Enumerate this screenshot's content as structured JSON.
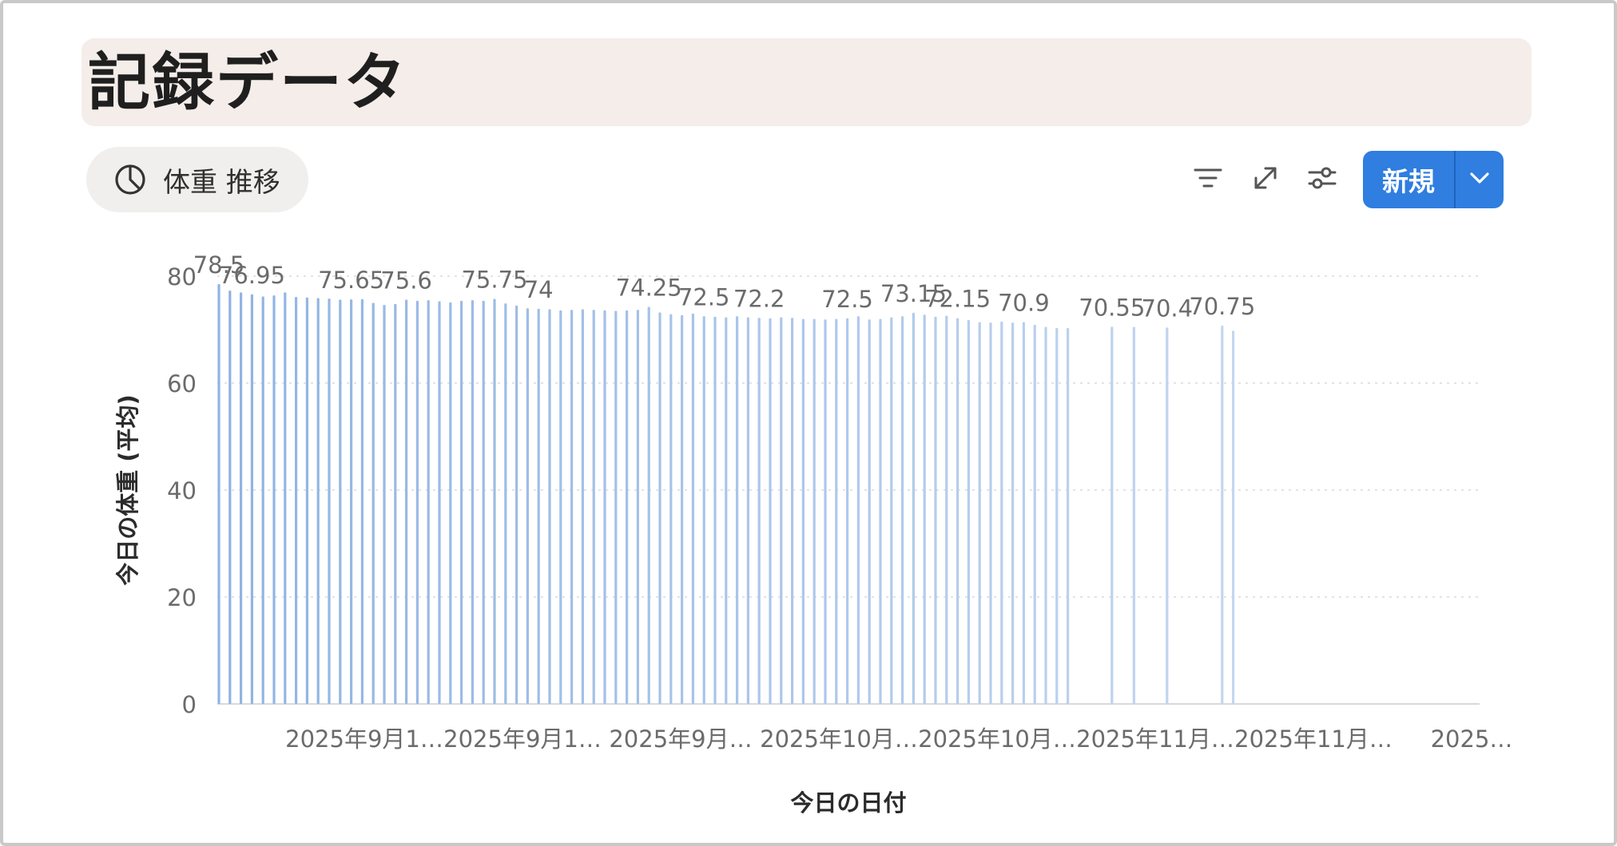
{
  "page": {
    "title": "記録データ"
  },
  "view": {
    "tab_label": "体重 推移"
  },
  "toolbar": {
    "new_label": "新規"
  },
  "icons": {
    "view_tab": "pie-chart-icon",
    "filter": "filter-icon",
    "expand": "expand-icon",
    "settings": "sliders-icon",
    "dropdown": "chevron-down-icon"
  },
  "colors": {
    "accent": "#2f7ee0",
    "bar_start": "#8fb3e3",
    "bar_end": "#c4d6f0"
  },
  "chart_data": {
    "type": "bar",
    "ylabel": "今日の体重 (平均)",
    "xlabel": "今日の日付",
    "ylim": [
      0,
      80
    ],
    "yticks": [
      0,
      20,
      40,
      60,
      80
    ],
    "grid": true,
    "x_tick_labels": [
      "2025年9月1…",
      "2025年9月1…",
      "2025年9月…",
      "2025年10月…",
      "2025年10月…",
      "2025年11月…",
      "2025年11月…",
      "2025…"
    ],
    "values": [
      78.5,
      77.3,
      76.95,
      76.6,
      76.2,
      76.4,
      76.95,
      76.1,
      76.0,
      75.9,
      75.8,
      75.6,
      75.65,
      75.7,
      75.0,
      74.6,
      74.8,
      75.6,
      75.4,
      75.5,
      75.3,
      75.1,
      75.4,
      75.5,
      75.4,
      75.75,
      74.9,
      74.5,
      74.0,
      73.9,
      73.8,
      73.6,
      73.7,
      73.8,
      73.7,
      73.6,
      73.5,
      73.6,
      73.7,
      74.25,
      73.2,
      72.9,
      72.7,
      73.0,
      72.5,
      72.4,
      72.3,
      72.5,
      72.3,
      72.2,
      72.1,
      72.3,
      72.2,
      72.0,
      72.0,
      71.9,
      72.0,
      72.1,
      72.5,
      71.9,
      72.0,
      72.3,
      72.5,
      73.15,
      72.8,
      72.4,
      72.6,
      72.15,
      71.8,
      71.4,
      71.3,
      71.5,
      71.3,
      71.4,
      70.9,
      70.5,
      70.3,
      70.3,
      null,
      null,
      null,
      70.55,
      null,
      70.5,
      null,
      null,
      70.4,
      null,
      null,
      null,
      null,
      70.75,
      69.8
    ],
    "data_labels": [
      {
        "index": 0,
        "text": "78.5"
      },
      {
        "index": 3,
        "text": "76.95"
      },
      {
        "index": 12,
        "text": "75.65"
      },
      {
        "index": 17,
        "text": "75.6"
      },
      {
        "index": 25,
        "text": "75.75"
      },
      {
        "index": 29,
        "text": "74"
      },
      {
        "index": 39,
        "text": "74.25"
      },
      {
        "index": 44,
        "text": "72.5"
      },
      {
        "index": 49,
        "text": "72.2"
      },
      {
        "index": 57,
        "text": "72.5"
      },
      {
        "index": 63,
        "text": "73.15"
      },
      {
        "index": 67,
        "text": "72.15"
      },
      {
        "index": 73,
        "text": "70.9"
      },
      {
        "index": 81,
        "text": "70.55"
      },
      {
        "index": 86,
        "text": "70.4"
      },
      {
        "index": 91,
        "text": "70.75"
      }
    ]
  }
}
